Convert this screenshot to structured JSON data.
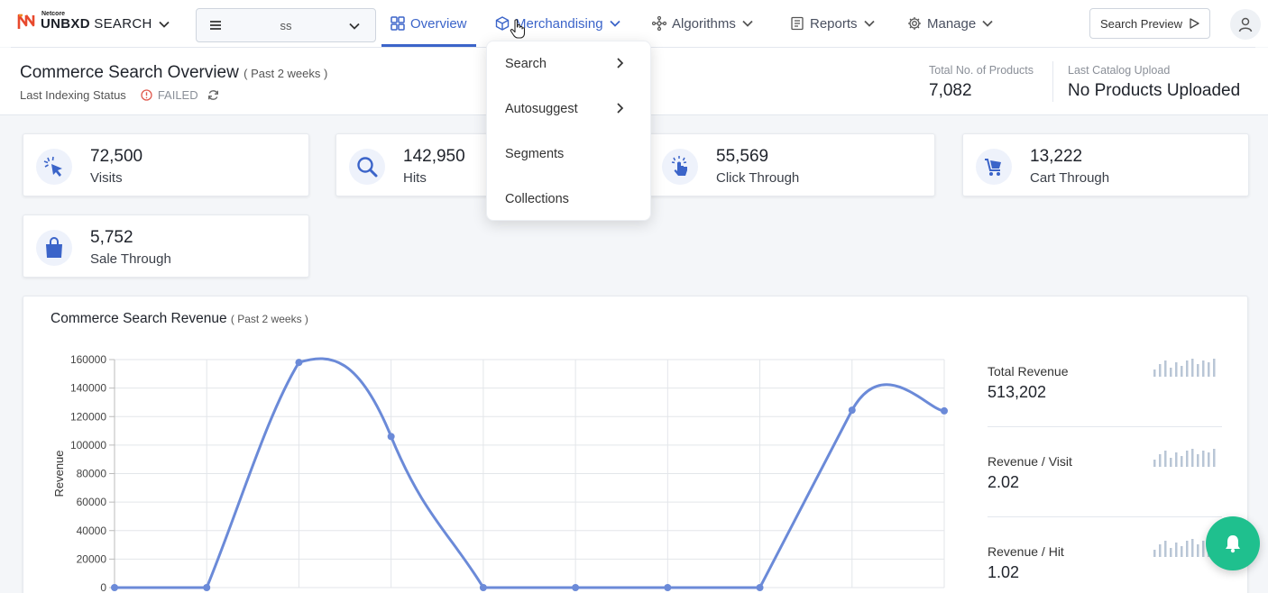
{
  "brand": {
    "small": "Netcore",
    "main_bold": "UNBXD",
    "main_thin": " SEARCH"
  },
  "site_select": {
    "value": "ss"
  },
  "nav": {
    "overview": "Overview",
    "merchandising": "Merchandising",
    "algorithms": "Algorithms",
    "reports": "Reports",
    "manage": "Manage"
  },
  "search_preview": "Search Preview",
  "overview": {
    "title": "Commerce Search Overview",
    "period": "( Past 2 weeks )",
    "indexing_label": "Last Indexing Status",
    "indexing_status": "FAILED",
    "total_products_label": "Total No. of Products",
    "total_products_value": "7,082",
    "last_upload_label": "Last Catalog Upload",
    "last_upload_value": "No Products Uploaded"
  },
  "metrics": [
    {
      "value": "72,500",
      "label": "Visits",
      "icon": "cursor-click-icon"
    },
    {
      "value": "142,950",
      "label": "Hits",
      "icon": "search-icon"
    },
    {
      "value": "55,569",
      "label": "Click Through",
      "icon": "tap-hand-icon"
    },
    {
      "value": "13,222",
      "label": "Cart Through",
      "icon": "cart-icon"
    },
    {
      "value": "5,752",
      "label": "Sale Through",
      "icon": "shopping-bag-icon"
    }
  ],
  "merch_menu": [
    {
      "label": "Search",
      "has_submenu": true
    },
    {
      "label": "Autosuggest",
      "has_submenu": true
    },
    {
      "label": "Segments",
      "has_submenu": false
    },
    {
      "label": "Collections",
      "has_submenu": false
    }
  ],
  "revenue": {
    "title": "Commerce Search Revenue",
    "period": "( Past 2 weeks )",
    "kpis": [
      {
        "label": "Total Revenue",
        "value": "513,202"
      },
      {
        "label": "Revenue / Visit",
        "value": "2.02"
      },
      {
        "label": "Revenue / Hit",
        "value": "1.02"
      }
    ]
  },
  "colors": {
    "accent": "#3b64c9",
    "line": "#6b8ad8",
    "bell": "#1fc08e",
    "failed": "#e05a4f"
  },
  "chart_data": {
    "type": "line",
    "title": "",
    "xlabel": "",
    "ylabel": "Revenue",
    "ylim": [
      0,
      160000
    ],
    "yticks": [
      0,
      20000,
      40000,
      60000,
      80000,
      100000,
      120000,
      140000,
      160000
    ],
    "grid": true,
    "series": [
      {
        "values": [
          0,
          0,
          158000,
          106000,
          0,
          0,
          0,
          0,
          124500,
          124000
        ]
      }
    ]
  }
}
